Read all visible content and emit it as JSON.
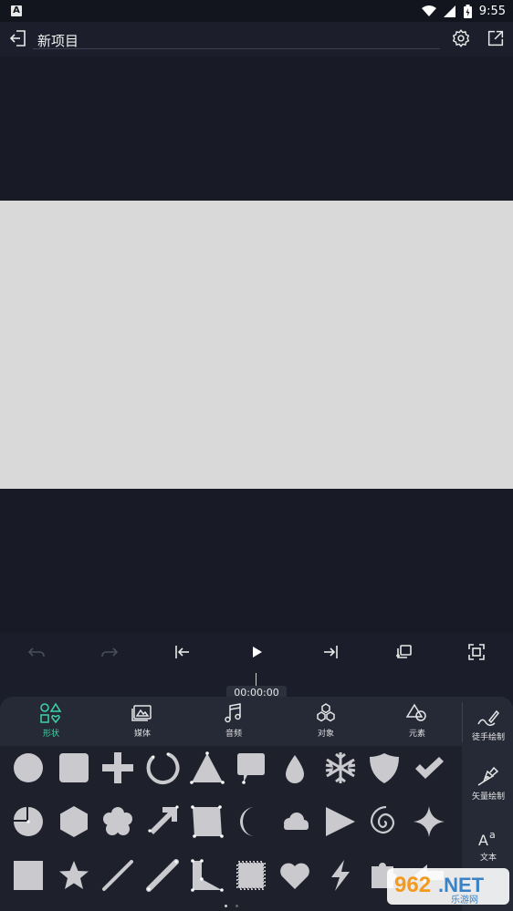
{
  "status_bar": {
    "notification_icon": "A",
    "time": "9:55",
    "icons": [
      "wifi-icon",
      "signal-icon",
      "battery-icon"
    ]
  },
  "header": {
    "title": "新项目",
    "icons": [
      "exit-icon",
      "settings-icon",
      "export-icon"
    ]
  },
  "playback": {
    "buttons": [
      "undo",
      "redo",
      "skip-to-start",
      "play",
      "skip-to-end",
      "duplicate-frame",
      "fullscreen"
    ]
  },
  "timeline": {
    "current_time": "00:00:00"
  },
  "tabs": [
    {
      "label": "形状",
      "icon": "shapes-icon",
      "active": true
    },
    {
      "label": "媒体",
      "icon": "media-icon",
      "active": false
    },
    {
      "label": "音频",
      "icon": "music-note-icon",
      "active": false
    },
    {
      "label": "对象",
      "icon": "objects-icon",
      "active": false
    },
    {
      "label": "元素",
      "icon": "elements-icon",
      "active": false
    }
  ],
  "side_tools": [
    {
      "label": "徒手绘制",
      "icon": "freehand-pen-icon"
    },
    {
      "label": "矢量绘制",
      "icon": "vector-pen-icon"
    },
    {
      "label": "文本",
      "icon": "text-icon"
    }
  ],
  "shapes_grid": [
    [
      "circle",
      "rounded-square",
      "plus",
      "ring",
      "triangle",
      "speech-bubble",
      "drop",
      "snowflake",
      "shield",
      "checkmark"
    ],
    [
      "pie",
      "hexagon",
      "flower",
      "arrow",
      "quadrilateral",
      "crescent",
      "cloud",
      "play-triangle",
      "spiral",
      "sparkle-star"
    ],
    [
      "square",
      "star",
      "line",
      "pencil-line",
      "corner-polygon",
      "stamp",
      "heart",
      "lightning",
      "puzzle",
      "arrow-left"
    ]
  ],
  "watermark": {
    "brand": "962.NET",
    "sub": "乐游网"
  },
  "colors": {
    "background": "#1b1e2a",
    "canvas": "#d9d9d9",
    "panel": "#262a37",
    "accent": "#3fd3a6",
    "shape_fill": "#c9c9ce"
  }
}
